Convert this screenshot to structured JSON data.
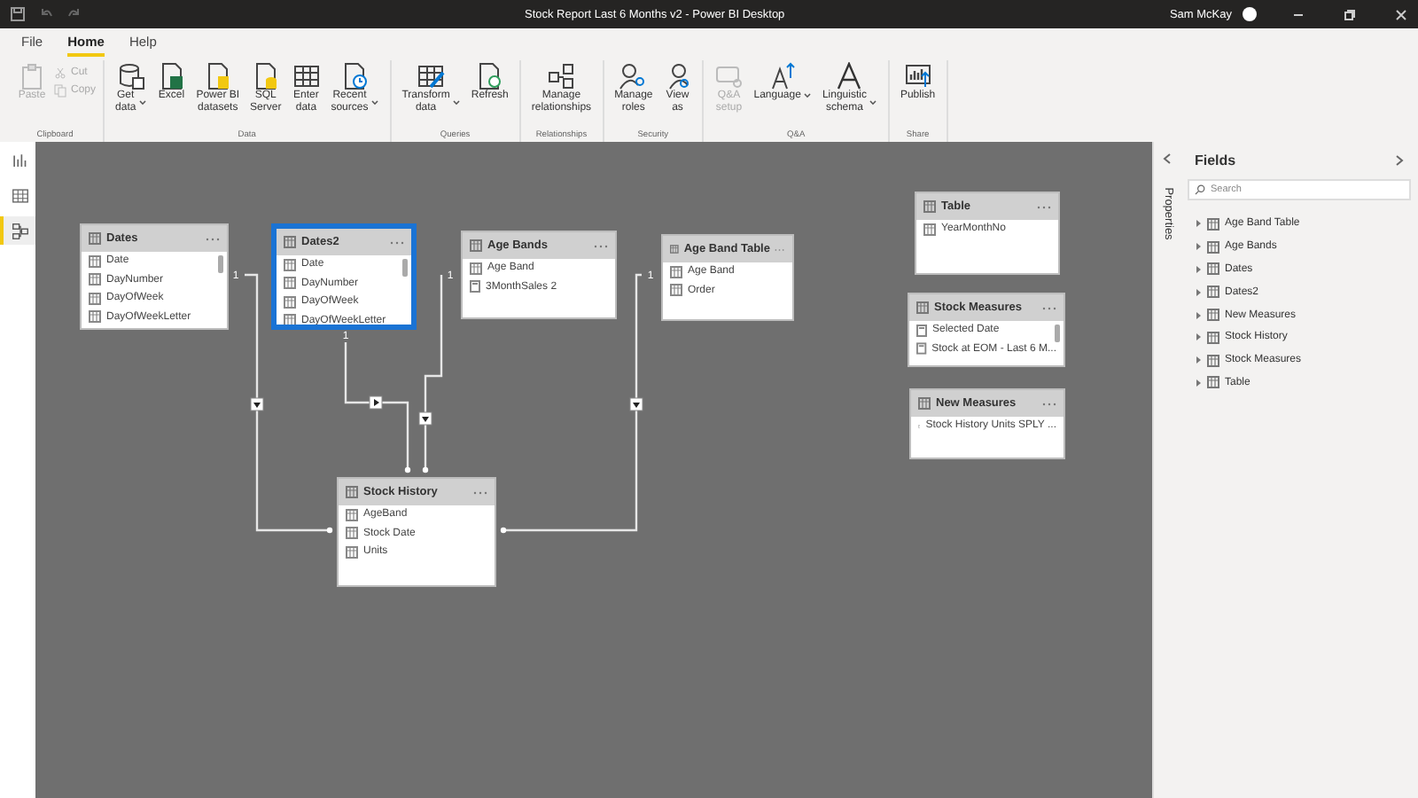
{
  "window": {
    "title": "Stock Report Last 6 Months v2 - Power BI Desktop",
    "user": "Sam McKay"
  },
  "ribbon_tabs": [
    {
      "label": "File",
      "selected": false
    },
    {
      "label": "Home",
      "selected": true
    },
    {
      "label": "Help",
      "selected": false
    }
  ],
  "ribbon_groups": [
    {
      "label": "Clipboard",
      "buttons": [
        {
          "label": "Paste",
          "kind": "large",
          "disabled": true,
          "dropdown": false
        },
        {
          "label": "Cut",
          "kind": "small",
          "disabled": true,
          "dropdown": false
        },
        {
          "label": "Copy",
          "kind": "small",
          "disabled": true,
          "dropdown": false
        }
      ]
    },
    {
      "label": "Data",
      "buttons": [
        {
          "label": "Get\ndata",
          "kind": "large",
          "disabled": false,
          "dropdown": true
        },
        {
          "label": "Excel",
          "kind": "large",
          "disabled": false,
          "dropdown": false
        },
        {
          "label": "Power BI\ndatasets",
          "kind": "large",
          "disabled": false,
          "dropdown": false
        },
        {
          "label": "SQL\nServer",
          "kind": "large",
          "disabled": false,
          "dropdown": false
        },
        {
          "label": "Enter\ndata",
          "kind": "large",
          "disabled": false,
          "dropdown": false
        },
        {
          "label": "Recent\nsources",
          "kind": "large",
          "disabled": false,
          "dropdown": true
        }
      ]
    },
    {
      "label": "Queries",
      "buttons": [
        {
          "label": "Transform\ndata",
          "kind": "large",
          "disabled": false,
          "dropdown": true
        },
        {
          "label": "Refresh",
          "kind": "large",
          "disabled": false,
          "dropdown": false
        }
      ]
    },
    {
      "label": "Relationships",
      "buttons": [
        {
          "label": "Manage\nrelationships",
          "kind": "large",
          "disabled": false,
          "dropdown": false
        }
      ]
    },
    {
      "label": "Security",
      "buttons": [
        {
          "label": "Manage\nroles",
          "kind": "large",
          "disabled": false,
          "dropdown": false
        },
        {
          "label": "View\nas",
          "kind": "large",
          "disabled": false,
          "dropdown": false
        }
      ]
    },
    {
      "label": "Q&A",
      "buttons": [
        {
          "label": "Q&A\nsetup",
          "kind": "large",
          "disabled": true,
          "dropdown": false
        },
        {
          "label": "Language",
          "kind": "large",
          "disabled": false,
          "dropdown": true
        },
        {
          "label": "Linguistic\nschema",
          "kind": "large",
          "disabled": false,
          "dropdown": true
        }
      ]
    },
    {
      "label": "Share",
      "buttons": [
        {
          "label": "Publish",
          "kind": "large",
          "disabled": false,
          "dropdown": false
        }
      ]
    }
  ],
  "views": [
    {
      "selected": false
    },
    {
      "selected": false
    },
    {
      "selected": true
    }
  ],
  "model_tables": [
    {
      "name": "Dates",
      "selected": false,
      "fields": [
        {
          "name": "Date",
          "kind": "column"
        },
        {
          "name": "DayNumber",
          "kind": "column"
        },
        {
          "name": "DayOfWeek",
          "kind": "column"
        },
        {
          "name": "DayOfWeekLetter",
          "kind": "column"
        }
      ]
    },
    {
      "name": "Dates2",
      "selected": true,
      "fields": [
        {
          "name": "Date",
          "kind": "column"
        },
        {
          "name": "DayNumber",
          "kind": "column"
        },
        {
          "name": "DayOfWeek",
          "kind": "column"
        },
        {
          "name": "DayOfWeekLetter",
          "kind": "column"
        }
      ]
    },
    {
      "name": "Age Bands",
      "selected": false,
      "fields": [
        {
          "name": "Age Band",
          "kind": "column"
        },
        {
          "name": "3MonthSales 2",
          "kind": "measure"
        }
      ]
    },
    {
      "name": "Age Band Table",
      "selected": false,
      "fields": [
        {
          "name": "Age Band",
          "kind": "column"
        },
        {
          "name": "Order",
          "kind": "column"
        }
      ]
    },
    {
      "name": "Table",
      "selected": false,
      "fields": [
        {
          "name": "YearMonthNo",
          "kind": "column"
        }
      ]
    },
    {
      "name": "Stock Measures",
      "selected": false,
      "fields": [
        {
          "name": "Selected Date",
          "kind": "measure"
        },
        {
          "name": "Stock at EOM - Last 6 M...",
          "kind": "measure"
        }
      ]
    },
    {
      "name": "New Measures",
      "selected": false,
      "fields": [
        {
          "name": "Stock History Units SPLY ...",
          "kind": "measure"
        }
      ]
    },
    {
      "name": "Stock History",
      "selected": false,
      "fields": [
        {
          "name": "AgeBand",
          "kind": "column"
        },
        {
          "name": "Stock Date",
          "kind": "column"
        },
        {
          "name": "Units",
          "kind": "column"
        }
      ]
    }
  ],
  "relationships": [
    {
      "cardinality": "1"
    },
    {
      "cardinality": "1"
    },
    {
      "cardinality": "1"
    },
    {
      "cardinality": "1"
    }
  ],
  "properties_pane": {
    "label": "Properties"
  },
  "fields_pane": {
    "title": "Fields",
    "search": {
      "placeholder": "Search"
    },
    "items": [
      {
        "name": "Age Band Table",
        "expanded": false
      },
      {
        "name": "Age Bands",
        "expanded": false
      },
      {
        "name": "Dates",
        "expanded": false
      },
      {
        "name": "Dates2",
        "expanded": false
      },
      {
        "name": "New Measures",
        "expanded": false
      },
      {
        "name": "Stock History",
        "expanded": false
      },
      {
        "name": "Stock Measures",
        "expanded": false
      },
      {
        "name": "Table",
        "expanded": false
      }
    ]
  }
}
